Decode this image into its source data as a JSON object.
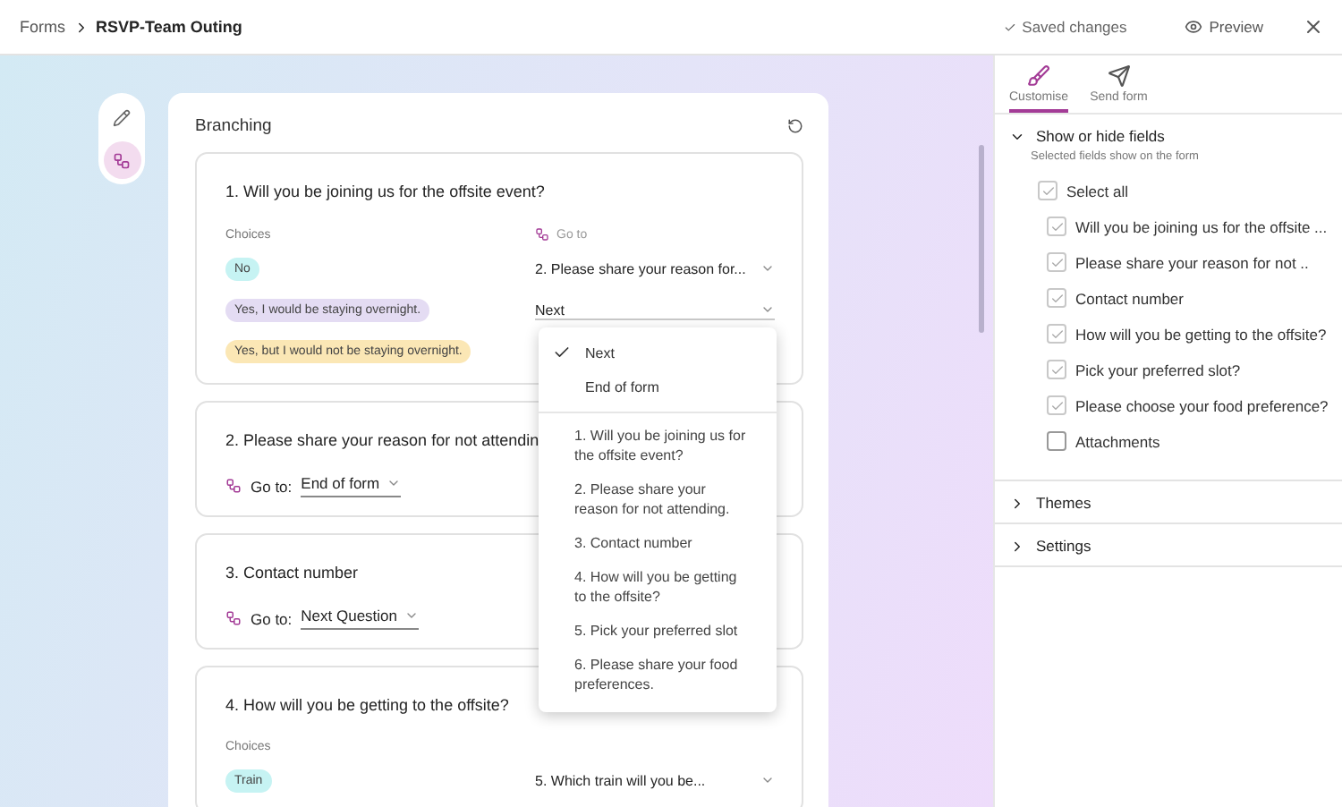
{
  "breadcrumb": {
    "root": "Forms",
    "current": "RSVP-Team Outing"
  },
  "header_actions": {
    "saved": "Saved changes",
    "preview": "Preview"
  },
  "tools": [
    {
      "kind": "edit",
      "selected": false
    },
    {
      "kind": "branch",
      "selected": true
    }
  ],
  "panel": {
    "title": "Branching"
  },
  "questions": [
    {
      "kind": "choices",
      "title": "1. Will you be joining us for the offsite event?",
      "choices_label": "Choices",
      "goto_label": "Go to",
      "choices": [
        {
          "label": "No",
          "color": "#c6f3f3",
          "goto": "2. Please share your reason for..."
        },
        {
          "label": "Yes, I would be staying overnight.",
          "color": "#e4dcf3",
          "goto": "Next",
          "expanded": true
        },
        {
          "label": "Yes, but I would not be staying overnight.",
          "color": "#fbe7b5"
        }
      ]
    },
    {
      "kind": "goto",
      "title": "2. Please share your reason for not attendin",
      "goto_prefix": "Go to:",
      "goto": "End of form"
    },
    {
      "kind": "goto",
      "title": "3. Contact number",
      "goto_prefix": "Go to:",
      "goto": "Next Question"
    },
    {
      "kind": "choices",
      "title": "4. How will you be getting to the offsite?",
      "choices_label": "Choices",
      "choices": [
        {
          "label": "Train",
          "color": "#c6f3f3",
          "goto": "5. Which train will you be..."
        }
      ]
    }
  ],
  "goto_menu": {
    "open": true,
    "items": [
      {
        "label": "Next",
        "selected": true
      },
      {
        "label": "End of form",
        "selected": false
      }
    ],
    "questions": [
      "1. Will you be joining us for the offsite event?",
      "2. Please share your reason for not attending.",
      "3. Contact number",
      "4. How will you be getting to the offsite?",
      "5. Pick your preferred slot",
      "6. Please share your food preferences."
    ]
  },
  "sidebar": {
    "tabs": [
      {
        "kind": "brush",
        "label": "Customise",
        "selected": true
      },
      {
        "kind": "send",
        "label": "Send form",
        "selected": false
      }
    ],
    "sections": [
      {
        "title": "Show or hide fields",
        "expanded": true,
        "subtitle": "Selected fields show on the form",
        "select_all": {
          "label": "Select all",
          "checked": true
        },
        "fields": [
          {
            "label": "Will you be joining us for the offsite ...",
            "checked": true
          },
          {
            "label": "Please share your reason for not ..",
            "checked": true
          },
          {
            "label": "Contact number",
            "checked": true
          },
          {
            "label": "How will you be getting to the offsite?",
            "checked": true
          },
          {
            "label": "Pick your preferred slot?",
            "checked": true
          },
          {
            "label": "Please choose your food preference?",
            "checked": true
          },
          {
            "label": "Attachments",
            "checked": false
          }
        ]
      },
      {
        "title": "Themes",
        "expanded": false
      },
      {
        "title": "Settings",
        "expanded": false
      }
    ]
  }
}
